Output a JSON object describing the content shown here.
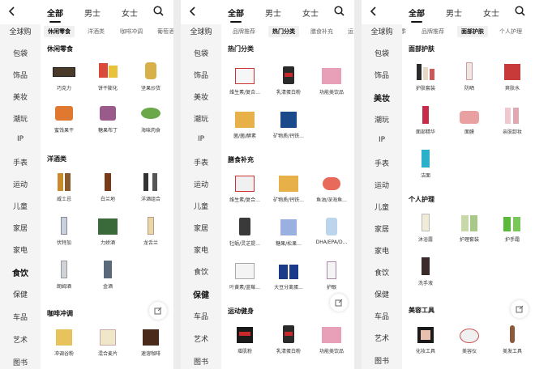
{
  "top_tabs": [
    "全部",
    "男士",
    "女士"
  ],
  "panels": [
    {
      "id": "p1",
      "active_side": 13,
      "sidebar": [
        "全球购",
        "包袋",
        "饰品",
        "美妆",
        "潮玩",
        "IP",
        "手表",
        "运动",
        "儿童",
        "家居",
        "家电",
        "食饮",
        "保健",
        "车品",
        "艺术",
        "图书"
      ],
      "subtabs": [
        "休闲零食",
        "洋酒类",
        "咖啡冲调",
        "葡萄酒"
      ],
      "active_subtab": 0,
      "sections": [
        {
          "title": "休闲零食",
          "items": [
            "巧克力",
            "饼干膨化",
            "坚果炒货",
            "蜜饯果干",
            "糖果布丁",
            "海味肉食"
          ]
        },
        {
          "title": "洋酒类",
          "items": [
            "威士忌",
            "白兰地",
            "洋酒组合",
            "伏特加",
            "力娇酒",
            "龙舌兰",
            "朗姆酒",
            "金酒"
          ]
        },
        {
          "title": "咖啡冲调",
          "items": [
            "冲调谷粉",
            "混合麦片",
            "速溶咖啡"
          ]
        }
      ]
    },
    {
      "id": "p2",
      "active_side": 12,
      "sidebar": [
        "全球购",
        "包袋",
        "饰品",
        "美妆",
        "潮玩",
        "IP",
        "手表",
        "运动",
        "儿童",
        "家居",
        "家电",
        "食饮",
        "保健",
        "车品",
        "艺术",
        "图书"
      ],
      "subtabs": [
        "品牌推荐",
        "热门分类",
        "膳食补充",
        "运"
      ],
      "active_subtab": 1,
      "sections": [
        {
          "title": "热门分类",
          "items": [
            "维生素/复合...",
            "乳清蛋白粉",
            "功能类饮品",
            "菌/菌/酵素",
            "矿物质/钙铁..."
          ]
        },
        {
          "title": "膳食补充",
          "items": [
            "维生素/复合...",
            "矿物质/钙铁...",
            "鱼油/深海鱼...",
            "牡蛎/灵芝提...",
            "糖果/松果...",
            "DHA/EPA/D...",
            "叶黄素/蓝莓...",
            "大豆分离蛋...",
            "护眼"
          ]
        },
        {
          "title": "运动健身",
          "items": [
            "增肌粉",
            "乳清蛋白粉",
            "功能类饮品"
          ]
        }
      ]
    },
    {
      "id": "p3",
      "active_side": 3,
      "sidebar": [
        "全球购",
        "包袋",
        "饰品",
        "美妆",
        "潮玩",
        "IP",
        "手表",
        "运动",
        "儿童",
        "家居",
        "家电",
        "食饮",
        "保健",
        "车品",
        "艺术",
        "图书"
      ],
      "subtabs": [
        "季",
        "品牌推荐",
        "面部护肤",
        "个人护理"
      ],
      "active_subtab": 2,
      "sections": [
        {
          "title": "面部护肤",
          "items": [
            "护肤套装",
            "防晒",
            "爽肤水",
            "面部精华",
            "面膜",
            "亲肤卸妆",
            "洁面"
          ]
        },
        {
          "title": "个人护理",
          "items": [
            "沐浴露",
            "护理套装",
            "护手霜",
            "洗手液"
          ]
        },
        {
          "title": "美容工具",
          "items": [
            "化妆工具",
            "美容仪",
            "美发工具"
          ]
        }
      ]
    }
  ],
  "colors": {
    "sidebar_bg": "#f4f4f4",
    "active_tab_bg": "#f0f0f0",
    "text": "#222222"
  },
  "icons": {
    "back": "chevron-left-icon",
    "search": "search-icon",
    "float": "share-icon"
  }
}
